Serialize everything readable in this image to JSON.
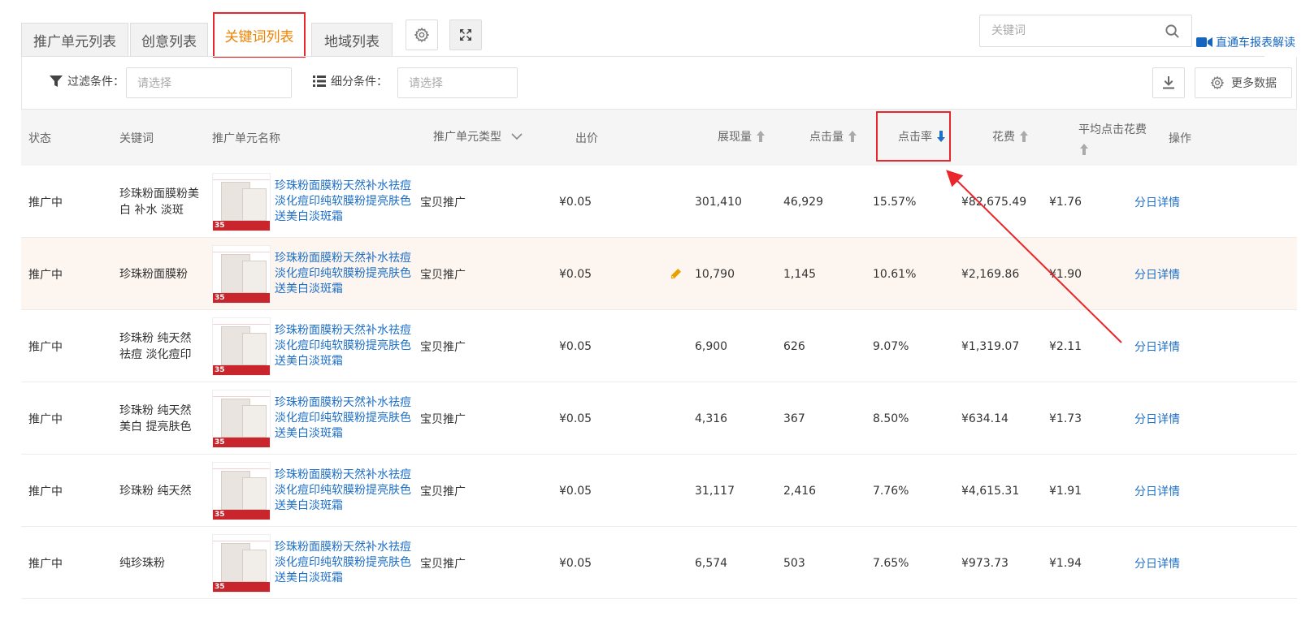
{
  "tabs": [
    {
      "label": "推广单元列表"
    },
    {
      "label": "创意列表"
    },
    {
      "label": "关键词列表"
    },
    {
      "label": "地域列表"
    }
  ],
  "search": {
    "placeholder": "关键词"
  },
  "guide_link": "直通车报表解读",
  "filter": {
    "label": "过滤条件：",
    "placeholder": "请选择"
  },
  "segment": {
    "label": "细分条件：",
    "placeholder": "请选择"
  },
  "more_data_label": "更多数据",
  "columns": {
    "status": "状态",
    "keyword": "关键词",
    "unit_name": "推广单元名称",
    "unit_type": "推广单元类型",
    "bid": "出价",
    "impressions": "展现量",
    "clicks": "点击量",
    "ctr": "点击率",
    "cost": "花费",
    "avg_cpc": "平均点击花费",
    "action": "操作"
  },
  "rows": [
    {
      "status": "推广中",
      "keyword": "珍珠粉面膜粉美白 补水 淡斑",
      "unit_name": "珍珠粉面膜粉天然补水祛痘淡化痘印纯软膜粉提亮肤色送美白淡斑霜",
      "unit_type": "宝贝推广",
      "bid": "¥0.05",
      "impressions": "301,410",
      "clicks": "46,929",
      "ctr": "15.57%",
      "cost": "¥82,675.49",
      "avg_cpc": "¥1.76",
      "action": "分日详情"
    },
    {
      "status": "推广中",
      "keyword": "珍珠粉面膜粉",
      "unit_name": "珍珠粉面膜粉天然补水祛痘淡化痘印纯软膜粉提亮肤色送美白淡斑霜",
      "unit_type": "宝贝推广",
      "bid": "¥0.05",
      "impressions": "10,790",
      "clicks": "1,145",
      "ctr": "10.61%",
      "cost": "¥2,169.86",
      "avg_cpc": "¥1.90",
      "action": "分日详情"
    },
    {
      "status": "推广中",
      "keyword": "珍珠粉 纯天然 祛痘 淡化痘印",
      "unit_name": "珍珠粉面膜粉天然补水祛痘淡化痘印纯软膜粉提亮肤色送美白淡斑霜",
      "unit_type": "宝贝推广",
      "bid": "¥0.05",
      "impressions": "6,900",
      "clicks": "626",
      "ctr": "9.07%",
      "cost": "¥1,319.07",
      "avg_cpc": "¥2.11",
      "action": "分日详情"
    },
    {
      "status": "推广中",
      "keyword": "珍珠粉 纯天然 美白 提亮肤色",
      "unit_name": "珍珠粉面膜粉天然补水祛痘淡化痘印纯软膜粉提亮肤色送美白淡斑霜",
      "unit_type": "宝贝推广",
      "bid": "¥0.05",
      "impressions": "4,316",
      "clicks": "367",
      "ctr": "8.50%",
      "cost": "¥634.14",
      "avg_cpc": "¥1.73",
      "action": "分日详情"
    },
    {
      "status": "推广中",
      "keyword": "珍珠粉 纯天然",
      "unit_name": "珍珠粉面膜粉天然补水祛痘淡化痘印纯软膜粉提亮肤色送美白淡斑霜",
      "unit_type": "宝贝推广",
      "bid": "¥0.05",
      "impressions": "31,117",
      "clicks": "2,416",
      "ctr": "7.76%",
      "cost": "¥4,615.31",
      "avg_cpc": "¥1.91",
      "action": "分日详情"
    },
    {
      "status": "推广中",
      "keyword": "纯珍珠粉",
      "unit_name": "珍珠粉面膜粉天然补水祛痘淡化痘印纯软膜粉提亮肤色送美白淡斑霜",
      "unit_type": "宝贝推广",
      "bid": "¥0.05",
      "impressions": "6,574",
      "clicks": "503",
      "ctr": "7.65%",
      "cost": "¥973.73",
      "avg_cpc": "¥1.94",
      "action": "分日详情"
    }
  ],
  "thumb_price": "35",
  "colors": {
    "accent": "#f08200",
    "highlight_box": "#e8262c",
    "link": "#1e6fc6",
    "row_highlight": "#fdf5ef"
  }
}
